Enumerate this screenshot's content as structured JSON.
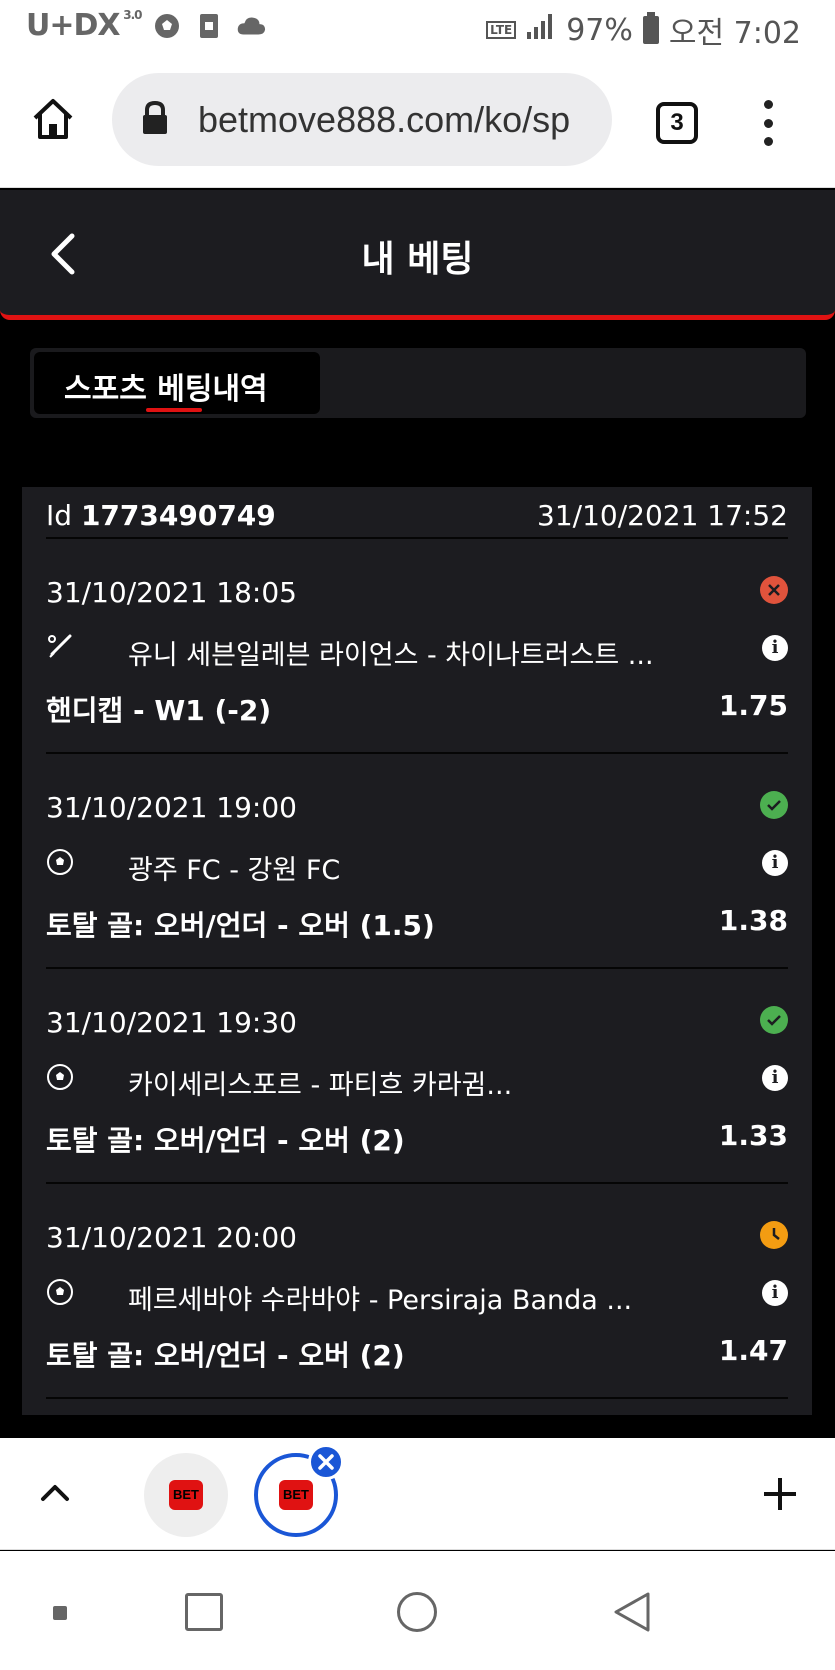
{
  "status_bar": {
    "carrier": "U+DX",
    "carrier_version": "3.0",
    "network": "LTE",
    "battery": "97%",
    "time": "오전 7:02"
  },
  "browser": {
    "url": "betmove888.com/ko/sp",
    "tab_count": "3"
  },
  "header": {
    "title": "내 베팅"
  },
  "tabs": [
    {
      "label": "스포츠 베팅내역",
      "active": true
    }
  ],
  "bet": {
    "id_label": "Id",
    "id": "1773490749",
    "created": "31/10/2021 17:52",
    "selections": [
      {
        "date": "31/10/2021 18:05",
        "status": "lost",
        "sport": "baseball-icon",
        "match": "유니 세븐일레븐 라이언스 - 차이나트러스트 ...",
        "market": "핸디캡 - W1 (-2)",
        "odds": "1.75"
      },
      {
        "date": "31/10/2021 19:00",
        "status": "won",
        "sport": "soccer-ball-icon",
        "match": "광주 FC - 강원 FC",
        "market": "토탈 골: 오버/언더 - 오버 (1.5)",
        "odds": "1.38"
      },
      {
        "date": "31/10/2021 19:30",
        "status": "won",
        "sport": "soccer-ball-icon",
        "match": "카이세리스포르 - 파티흐 카라귐...",
        "market": "토탈 골: 오버/언더 - 오버 (2)",
        "odds": "1.33"
      },
      {
        "date": "31/10/2021 20:00",
        "status": "pending",
        "sport": "soccer-ball-icon",
        "match": "페르세바야 수라바야 - Persiraja Banda ...",
        "market": "토탈 골: 오버/언더 - 오버 (2)",
        "odds": "1.47"
      }
    ]
  },
  "bottom_tabs": [
    {
      "logo": "BET"
    },
    {
      "logo": "BET"
    }
  ],
  "colors": {
    "accent": "#e01212",
    "lost": "#e0533c",
    "won": "#4caf50",
    "pending": "#f39c12",
    "card": "#1c1c20"
  }
}
